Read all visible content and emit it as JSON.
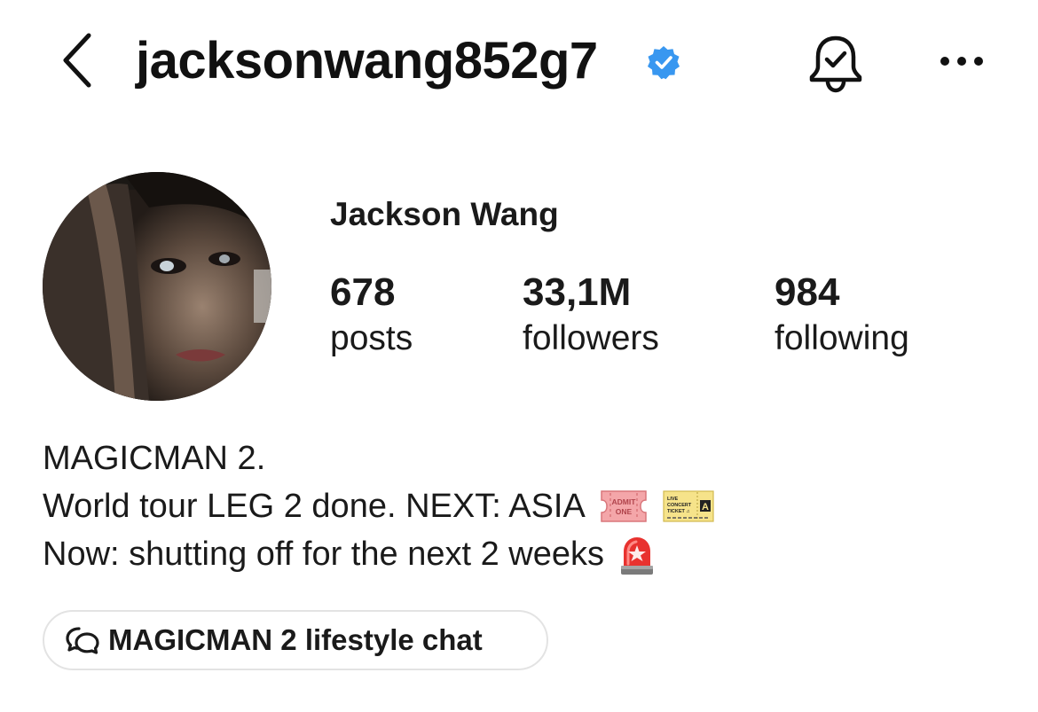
{
  "header": {
    "username": "jacksonwang852g7",
    "back_icon": "chevron-left-icon",
    "verified_icon": "verified-badge-icon",
    "notifications_icon": "bell-check-icon",
    "more_icon": "more-horizontal-icon"
  },
  "profile": {
    "display_name": "Jackson Wang",
    "avatar": "profile-photo",
    "stats": {
      "posts_count": "678",
      "posts_label": "posts",
      "followers_count": "33,1M",
      "followers_label": "followers",
      "following_count": "984",
      "following_label": "following"
    }
  },
  "bio": {
    "line1": "MAGICMAN 2.",
    "line2": "World tour LEG 2 done. NEXT: ASIA",
    "line3": "Now: shutting off for the next 2 weeks",
    "ticket_emoji_text": "ADMIT ONE",
    "concert_ticket_text_1": "LIVE",
    "concert_ticket_text_2": "CONCERT",
    "concert_ticket_text_3": "TICKET",
    "concert_ticket_zone": "A",
    "siren_icon": "police-light-icon"
  },
  "chat_channel": {
    "label": "MAGICMAN 2 lifestyle chat",
    "icon": "chat-bubbles-icon"
  },
  "colors": {
    "text": "#1a1a1a",
    "verified_blue": "#3897f0",
    "chip_border": "#e3e3e3",
    "background": "#ffffff"
  }
}
